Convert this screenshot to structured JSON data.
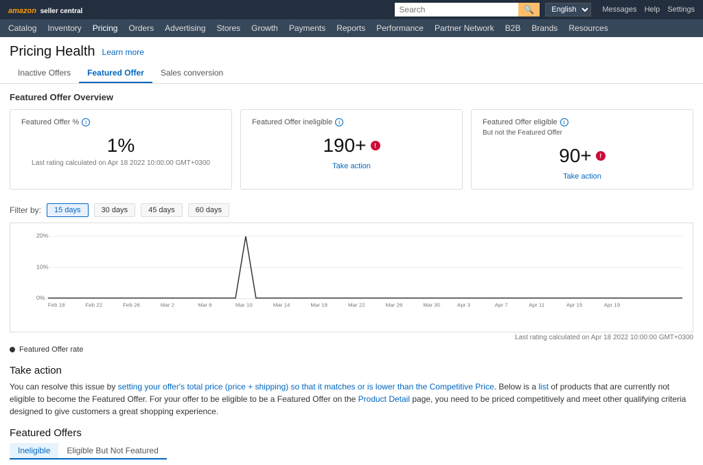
{
  "header": {
    "logo": "amazon",
    "seller_central": "seller central",
    "lang": "English",
    "search_placeholder": "Search",
    "messages": "Messages",
    "help": "Help",
    "settings": "Settings"
  },
  "nav": {
    "items": [
      {
        "label": "Catalog",
        "active": false
      },
      {
        "label": "Inventory",
        "active": false
      },
      {
        "label": "Pricing",
        "active": true
      },
      {
        "label": "Orders",
        "active": false
      },
      {
        "label": "Advertising",
        "active": false
      },
      {
        "label": "Stores",
        "active": false
      },
      {
        "label": "Growth",
        "active": false
      },
      {
        "label": "Payments",
        "active": false
      },
      {
        "label": "Reports",
        "active": false
      },
      {
        "label": "Performance",
        "active": false
      },
      {
        "label": "Partner Network",
        "active": false
      },
      {
        "label": "B2B",
        "active": false
      },
      {
        "label": "Brands",
        "active": false
      },
      {
        "label": "Resources",
        "active": false
      }
    ]
  },
  "page": {
    "title": "Pricing Health",
    "learn_more": "Learn more"
  },
  "tabs": [
    {
      "label": "Inactive Offers",
      "active": false
    },
    {
      "label": "Featured Offer",
      "active": true
    },
    {
      "label": "Sales conversion",
      "active": false
    }
  ],
  "overview": {
    "title": "Featured Offer Overview",
    "cards": [
      {
        "title": "Featured Offer %",
        "value": "1%",
        "note": "Last rating calculated on Apr 18 2022 10:00:00 GMT+0300",
        "has_action": false
      },
      {
        "title": "Featured Offer ineligible",
        "value": "190+",
        "has_alert": true,
        "action": "Take action",
        "has_action": true
      },
      {
        "title": "Featured Offer eligible",
        "subtitle": "But not the Featured Offer",
        "value": "90+",
        "has_alert": true,
        "action": "Take action",
        "has_action": true
      }
    ]
  },
  "filter": {
    "label": "Filter by:",
    "options": [
      {
        "label": "15 days",
        "active": true
      },
      {
        "label": "30 days",
        "active": false
      },
      {
        "label": "45 days",
        "active": false
      },
      {
        "label": "60 days",
        "active": false
      }
    ]
  },
  "chart": {
    "note": "Last rating calculated on Apr 18 2022 10:00:00 GMT+0300",
    "legend": "Featured Offer rate",
    "x_labels": [
      "Feb 18",
      "Feb 22",
      "Feb 26",
      "Mar 2",
      "Mar 6",
      "Mar 10",
      "Mar 14",
      "Mar 18",
      "Mar 22",
      "Mar 26",
      "Mar 30",
      "Apr 3",
      "Apr 7",
      "Apr 11",
      "Apr 15",
      "Apr 19"
    ],
    "y_labels": [
      "0%",
      "10%",
      "20%"
    ]
  },
  "take_action": {
    "title": "Take action",
    "text_parts": [
      "You can resolve this issue by setting your offer's total price (price + shipping) so that it matches or is lower than the Competitive Price. Below is a list of products that are currently not eligible to become the Featured Offer. For your offer to be eligible to be a Featured Offer on the Product Detail page, you need to be priced competitively and meet other qualifying criteria designed to give customers a great shopping experience."
    ]
  },
  "featured_offers": {
    "title": "Featured Offers",
    "subtabs": [
      {
        "label": "Ineligible",
        "active": true
      },
      {
        "label": "Eligible But Not Featured",
        "active": false
      }
    ]
  }
}
